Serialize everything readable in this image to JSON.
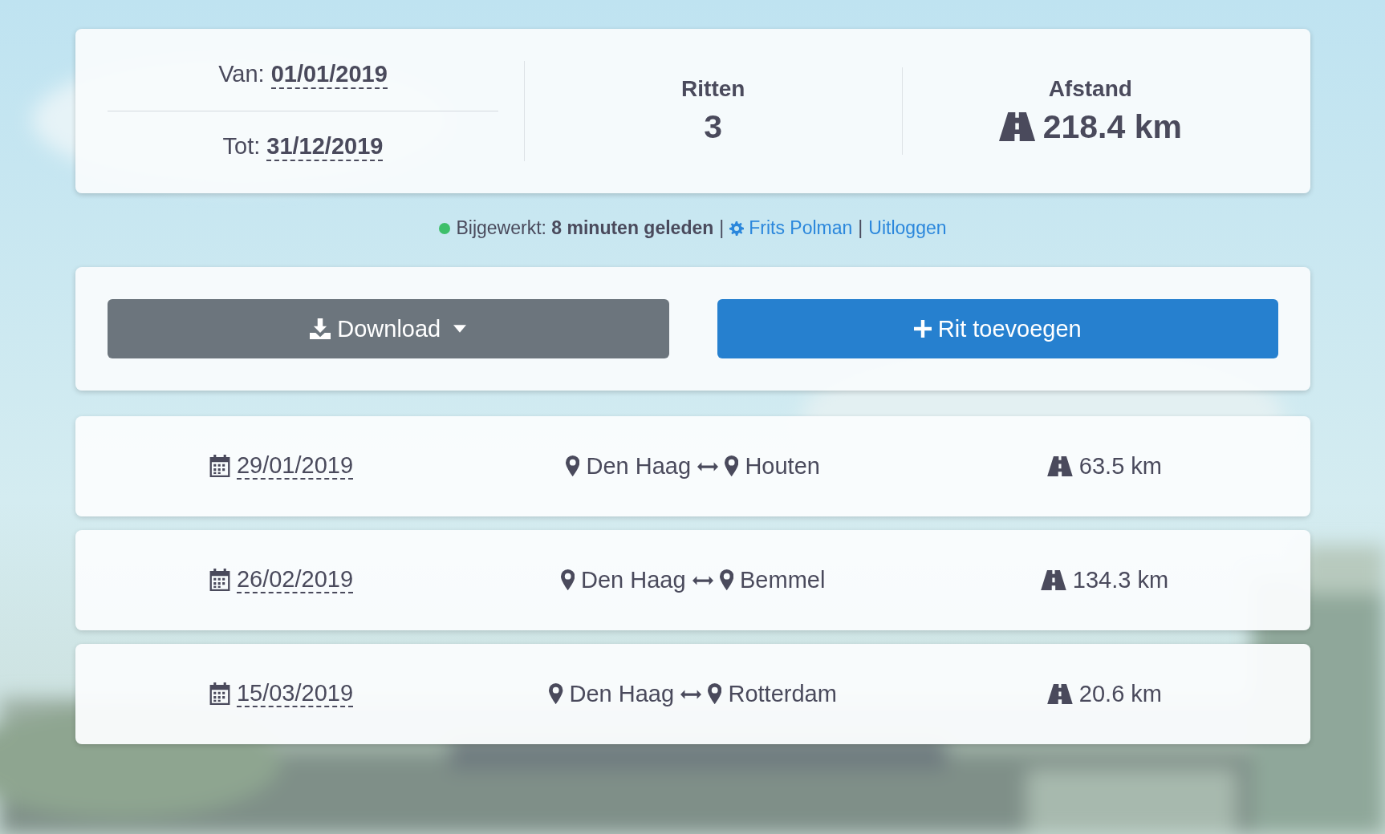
{
  "period": {
    "from_label": "Van:",
    "from": "01/01/2019",
    "to_label": "Tot:",
    "to": "31/12/2019"
  },
  "stats": [
    {
      "kind": "count",
      "label": "Ritten",
      "value": "3"
    },
    {
      "kind": "distance",
      "label": "Afstand",
      "value": "218.4 km"
    }
  ],
  "status": {
    "label": "Bijgewerkt:",
    "time": "8 minuten geleden",
    "separators": [
      "|",
      "|"
    ],
    "user": "Frits Polman",
    "logout": "Uitloggen"
  },
  "actions": [
    {
      "kind": "download",
      "label": "Download"
    },
    {
      "kind": "add",
      "label": "Rit toevoegen"
    }
  ],
  "trips": [
    {
      "date": "29/01/2019",
      "from": "Den Haag",
      "to": "Houten",
      "distance": "63.5 km"
    },
    {
      "date": "26/02/2019",
      "from": "Den Haag",
      "to": "Bemmel",
      "distance": "134.3 km"
    },
    {
      "date": "15/03/2019",
      "from": "Den Haag",
      "to": "Rotterdam",
      "distance": "20.6 km"
    }
  ]
}
